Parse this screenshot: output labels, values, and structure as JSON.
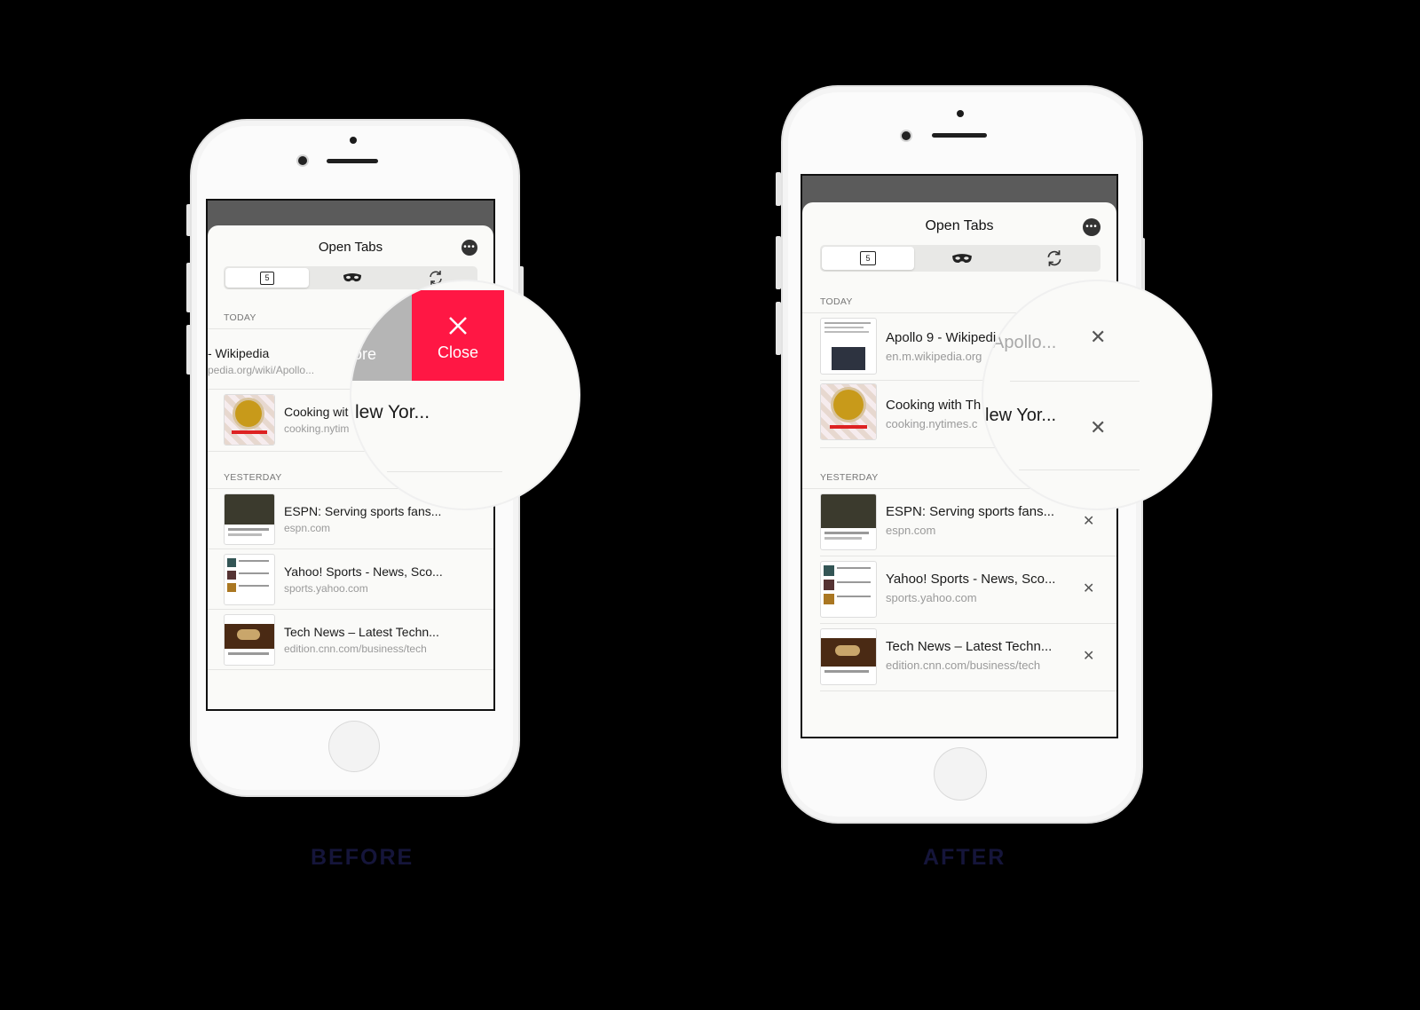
{
  "captions": {
    "before": "BEFORE",
    "after": "AFTER"
  },
  "colors": {
    "close_action": "#ff1744",
    "more_action": "#b5b5b5"
  },
  "before": {
    "title": "Open Tabs",
    "tab_count": "5",
    "sections": {
      "today": "TODAY",
      "yesterday": "YESTERDAY"
    },
    "rows": [
      {
        "title": "- Wikipedia",
        "url": "pedia.org/wiki/Apollo...",
        "icon": "wikipedia-thumb"
      },
      {
        "title": "Cooking wit",
        "url": "cooking.nytim",
        "icon": "food-thumb"
      },
      {
        "title": "ESPN: Serving sports fans...",
        "url": "espn.com",
        "icon": "sports-thumb"
      },
      {
        "title": "Yahoo! Sports - News, Sco...",
        "url": "sports.yahoo.com",
        "icon": "news-thumb"
      },
      {
        "title": "Tech News – Latest Techn...",
        "url": "edition.cnn.com/business/tech",
        "icon": "tech-thumb"
      }
    ],
    "swipe": {
      "more": "ore",
      "close": "Close"
    },
    "magnified_text": "lew Yor..."
  },
  "after": {
    "title": "Open Tabs",
    "tab_count": "5",
    "sections": {
      "today": "TODAY",
      "yesterday": "YESTERDAY"
    },
    "rows": [
      {
        "title": "Apollo 9 - Wikipedi",
        "url": "en.m.wikipedia.org",
        "icon": "wikipedia-thumb"
      },
      {
        "title": "Cooking with Th",
        "url": "cooking.nytimes.c",
        "icon": "food-thumb"
      },
      {
        "title": "ESPN: Serving sports fans...",
        "url": "espn.com",
        "icon": "sports-thumb"
      },
      {
        "title": "Yahoo! Sports - News, Sco...",
        "url": "sports.yahoo.com",
        "icon": "news-thumb"
      },
      {
        "title": "Tech News – Latest Techn...",
        "url": "edition.cnn.com/business/tech",
        "icon": "tech-thumb"
      }
    ],
    "magnified_url": "l/Apollo...",
    "magnified_text": "lew Yor..."
  }
}
